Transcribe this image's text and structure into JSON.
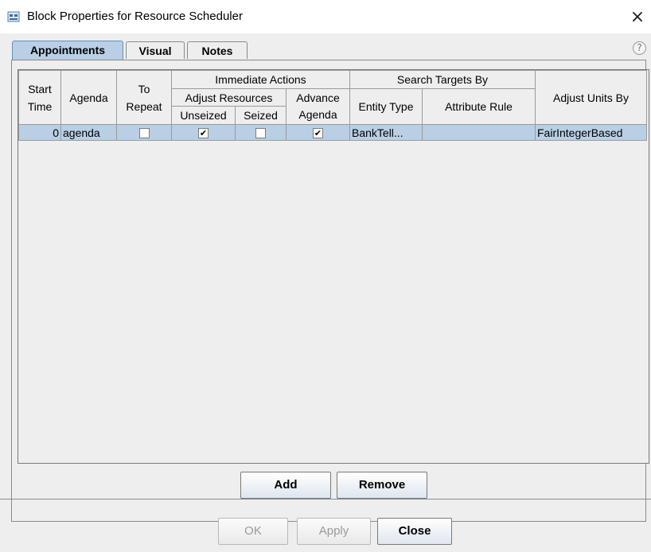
{
  "window": {
    "title": "Block Properties for Resource Scheduler",
    "close_glyph": "×"
  },
  "tabs": [
    {
      "label": "Appointments",
      "active": true
    },
    {
      "label": "Visual",
      "active": false
    },
    {
      "label": "Notes",
      "active": false
    }
  ],
  "help_glyph": "?",
  "table": {
    "headers": {
      "start_time": "Start Time",
      "agenda": "Agenda",
      "to_repeat": "To Repeat",
      "immediate_actions": "Immediate Actions",
      "adjust_resources": "Adjust Resources",
      "advance_agenda": "Advance Agenda",
      "unseized": "Unseized",
      "seized": "Seized",
      "search_targets_by": "Search Targets By",
      "entity_type": "Entity Type",
      "attribute_rule": "Attribute Rule",
      "adjust_units_by": "Adjust Units By"
    },
    "rows": [
      {
        "start_time": "0",
        "agenda": "agenda",
        "to_repeat": false,
        "unseized": true,
        "seized": false,
        "advance_agenda": true,
        "entity_type": "BankTell...",
        "attribute_rule": "",
        "adjust_units_by": "FairIntegerBased"
      }
    ]
  },
  "buttons": {
    "add": "Add",
    "remove": "Remove",
    "ok": "OK",
    "apply": "Apply",
    "close": "Close"
  },
  "checkmark_glyph": "✔",
  "colors": {
    "selection": "#b8cfe5",
    "background": "#eeeeee"
  }
}
